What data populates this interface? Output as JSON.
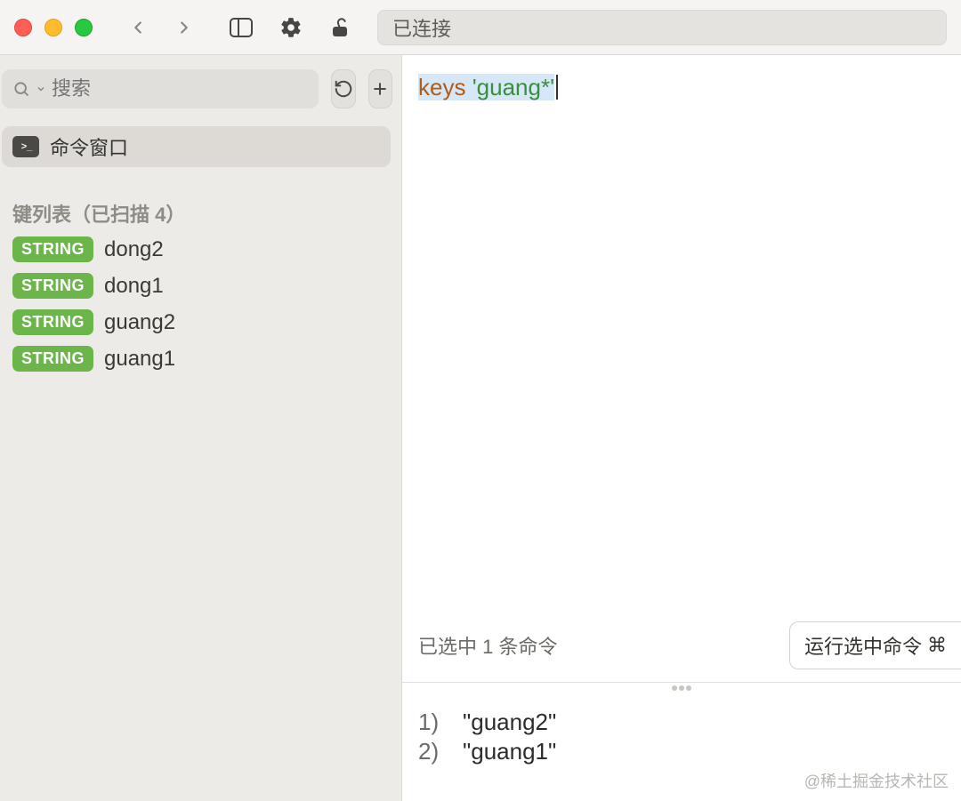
{
  "titlebar": {
    "address": "已连接"
  },
  "sidebar": {
    "search_placeholder": "搜索",
    "command_window_label": "命令窗口",
    "keys_header": "键列表（已扫描 4）",
    "keys": [
      {
        "type": "STRING",
        "name": "dong2"
      },
      {
        "type": "STRING",
        "name": "dong1"
      },
      {
        "type": "STRING",
        "name": "guang2"
      },
      {
        "type": "STRING",
        "name": "guang1"
      }
    ]
  },
  "editor": {
    "cmd_keyword": "keys",
    "cmd_arg": "'guang*'",
    "status_text": "已选中 1 条命令",
    "run_button_label": "运行选中命令",
    "output": [
      {
        "index": "1)",
        "value": "\"guang2\""
      },
      {
        "index": "2)",
        "value": "\"guang1\""
      }
    ]
  },
  "watermark": "@稀土掘金技术社区"
}
